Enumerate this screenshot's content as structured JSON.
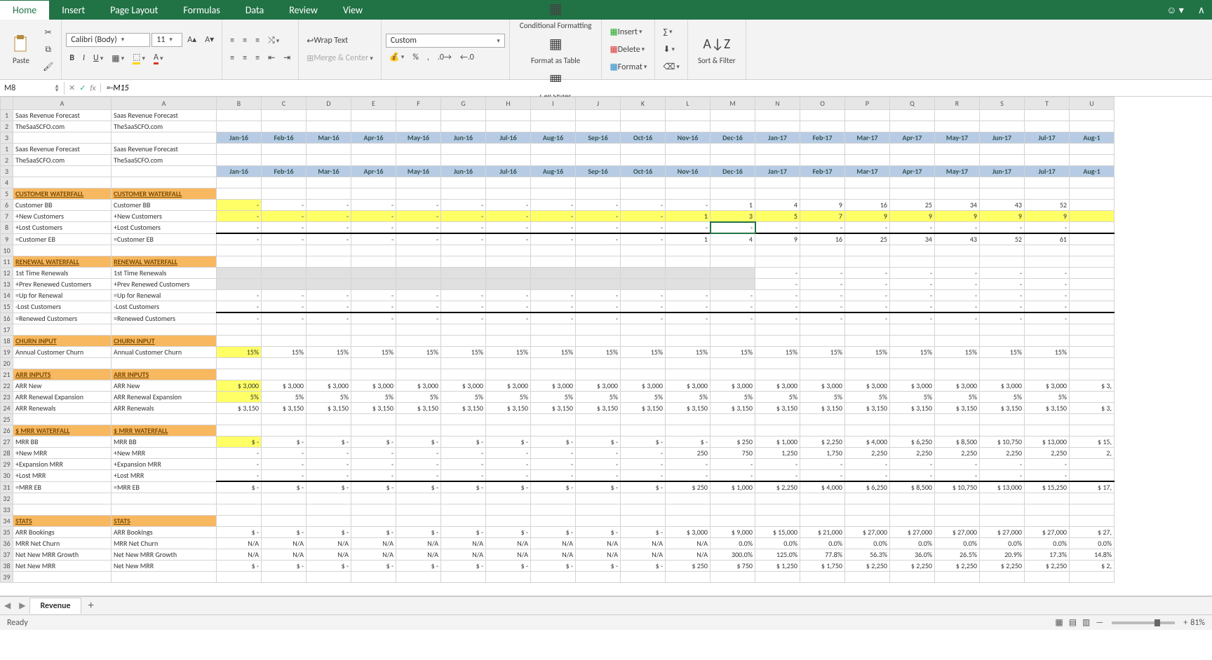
{
  "tabs": [
    "Home",
    "Insert",
    "Page Layout",
    "Formulas",
    "Data",
    "Review",
    "View"
  ],
  "activeTab": "Home",
  "ribbon": {
    "paste": "Paste",
    "font": "Calibri (Body)",
    "fontsize": "11",
    "wrap": "Wrap Text",
    "merge": "Merge & Center",
    "numfmt": "Custom",
    "cond": "Conditional Formatting",
    "fastbl": "Format as Table",
    "cellst": "Cell Styles",
    "insert": "Insert",
    "delete": "Delete",
    "format": "Format",
    "sortfilter": "Sort & Filter"
  },
  "namebox": "M8",
  "formula": "=-M15",
  "cols": [
    "",
    "A",
    "A",
    "B",
    "C",
    "D",
    "E",
    "F",
    "G",
    "H",
    "I",
    "J",
    "K",
    "L",
    "M",
    "N",
    "O",
    "P",
    "Q",
    "R",
    "S",
    "T",
    "U"
  ],
  "months": [
    "Jan-16",
    "Feb-16",
    "Mar-16",
    "Apr-16",
    "May-16",
    "Jun-16",
    "Jul-16",
    "Aug-16",
    "Sep-16",
    "Oct-16",
    "Nov-16",
    "Dec-16",
    "Jan-17",
    "Feb-17",
    "Mar-17",
    "Apr-17",
    "May-17",
    "Jun-17",
    "Jul-17",
    "Aug-1"
  ],
  "months2": [
    "Jan-16",
    "Feb-16",
    "Mar-16",
    "Apr-16",
    "May-16",
    "Jun-16",
    "Jul-16",
    "Aug-16",
    "Sep-16",
    "Oct-16",
    "Nov-16",
    "Dec-16",
    "Jan-17",
    "Feb-17",
    "Mar-17",
    "Apr-17",
    "May-17",
    "Jun-17",
    "Jul-17",
    "Aug-1"
  ],
  "labels": {
    "title": "Saas Revenue Forecast",
    "site": "TheSaaSCFO.com",
    "s_custw": "CUSTOMER WATERFALL",
    "custbb": "Customer BB",
    "newcust": "+New Customers",
    "lostcust": "+Lost Customers",
    "custeb": "=Customer EB",
    "s_renw": "RENEWAL WATERFALL",
    "first": "1st Time Renewals",
    "prev": "+Prev Renewed Customers",
    "upfor": "=Up for Renewal",
    "lostc": "-Lost Customers",
    "renewed": "=Renewed Customers",
    "s_churn": "CHURN INPUT",
    "annchurn": "Annual Customer Churn",
    "s_arr": "ARR INPUTS",
    "arrnew": "ARR New",
    "arrexp": "ARR Renewal Expansion",
    "arrren": "ARR Renewals",
    "s_mrrw": "$ MRR WATERFALL",
    "mrrbb": "MRR BB",
    "newmrr": "+New MRR",
    "expmrr": "+Expansion MRR",
    "lostmrr": "+Lost MRR",
    "mrreb": "=MRR EB",
    "s_stats": "STATS",
    "arrbook": "ARR Bookings",
    "mnc": "MRR Net Churn",
    "nngrowth": "Net New MRR Growth",
    "nnmrr": "Net New MRR"
  },
  "data": {
    "custbb": [
      "-",
      "-",
      "-",
      "-",
      "-",
      "-",
      "-",
      "-",
      "-",
      "-",
      "-",
      "1",
      "4",
      "9",
      "16",
      "25",
      "34",
      "43",
      "52",
      ""
    ],
    "newcust": [
      "-",
      "-",
      "-",
      "-",
      "-",
      "-",
      "-",
      "-",
      "-",
      "-",
      "1",
      "3",
      "5",
      "7",
      "9",
      "9",
      "9",
      "9",
      "9",
      ""
    ],
    "lostcust": [
      "-",
      "-",
      "-",
      "-",
      "-",
      "-",
      "-",
      "-",
      "-",
      "-",
      "-",
      "-",
      "-",
      "-",
      "-",
      "-",
      "-",
      "-",
      "-",
      ""
    ],
    "custeb": [
      "-",
      "-",
      "-",
      "-",
      "-",
      "-",
      "-",
      "-",
      "-",
      "-",
      "1",
      "4",
      "9",
      "16",
      "25",
      "34",
      "43",
      "52",
      "61",
      ""
    ],
    "first": [
      "",
      "",
      "",
      "",
      "",
      "",
      "",
      "",
      "",
      "",
      "",
      "",
      "-",
      "-",
      "-",
      "-",
      "-",
      "-",
      "-",
      ""
    ],
    "prev": [
      "",
      "",
      "",
      "",
      "",
      "",
      "",
      "",
      "",
      "",
      "",
      "",
      "-",
      "-",
      "-",
      "-",
      "-",
      "-",
      "-",
      ""
    ],
    "upfor": [
      "-",
      "-",
      "-",
      "-",
      "-",
      "-",
      "-",
      "-",
      "-",
      "-",
      "-",
      "-",
      "-",
      "-",
      "-",
      "-",
      "-",
      "-",
      "-",
      ""
    ],
    "lostc": [
      "-",
      "-",
      "-",
      "-",
      "-",
      "-",
      "-",
      "-",
      "-",
      "-",
      "-",
      "-",
      "-",
      "-",
      "-",
      "-",
      "-",
      "-",
      "-",
      ""
    ],
    "renewed": [
      "-",
      "-",
      "-",
      "-",
      "-",
      "-",
      "-",
      "-",
      "-",
      "-",
      "-",
      "-",
      "-",
      "-",
      "-",
      "-",
      "-",
      "-",
      "-",
      ""
    ],
    "churn": [
      "15%",
      "15%",
      "15%",
      "15%",
      "15%",
      "15%",
      "15%",
      "15%",
      "15%",
      "15%",
      "15%",
      "15%",
      "15%",
      "15%",
      "15%",
      "15%",
      "15%",
      "15%",
      "15%",
      ""
    ],
    "arrnew": [
      "$   3,000",
      "$   3,000",
      "$   3,000",
      "$   3,000",
      "$   3,000",
      "$   3,000",
      "$   3,000",
      "$   3,000",
      "$   3,000",
      "$   3,000",
      "$   3,000",
      "$   3,000",
      "$   3,000",
      "$   3,000",
      "$   3,000",
      "$   3,000",
      "$   3,000",
      "$   3,000",
      "$   3,000",
      "$   3,"
    ],
    "arrexp": [
      "5%",
      "5%",
      "5%",
      "5%",
      "5%",
      "5%",
      "5%",
      "5%",
      "5%",
      "5%",
      "5%",
      "5%",
      "5%",
      "5%",
      "5%",
      "5%",
      "5%",
      "5%",
      "5%",
      ""
    ],
    "arrren": [
      "$   3,150",
      "$   3,150",
      "$   3,150",
      "$   3,150",
      "$   3,150",
      "$   3,150",
      "$   3,150",
      "$   3,150",
      "$   3,150",
      "$   3,150",
      "$   3,150",
      "$   3,150",
      "$   3,150",
      "$   3,150",
      "$   3,150",
      "$   3,150",
      "$   3,150",
      "$   3,150",
      "$   3,150",
      "$   3,"
    ],
    "mrrbb": [
      "$   -",
      "$   -",
      "$   -",
      "$   -",
      "$   -",
      "$   -",
      "$   -",
      "$   -",
      "$   -",
      "$   -",
      "$   -",
      "$   250",
      "$   1,000",
      "$   2,250",
      "$   4,000",
      "$   6,250",
      "$   8,500",
      "$   10,750",
      "$   13,000",
      "$   15,"
    ],
    "newmrr": [
      "-",
      "-",
      "-",
      "-",
      "-",
      "-",
      "-",
      "-",
      "-",
      "-",
      "250",
      "750",
      "1,250",
      "1,750",
      "2,250",
      "2,250",
      "2,250",
      "2,250",
      "2,250",
      "2,"
    ],
    "expmrr": [
      "-",
      "-",
      "-",
      "-",
      "-",
      "-",
      "-",
      "-",
      "-",
      "-",
      "-",
      "-",
      "-",
      "-",
      "-",
      "-",
      "-",
      "-",
      "-",
      ""
    ],
    "lostmrr": [
      "-",
      "-",
      "-",
      "-",
      "-",
      "-",
      "-",
      "-",
      "-",
      "-",
      "-",
      "-",
      "-",
      "-",
      "-",
      "-",
      "-",
      "-",
      "-",
      ""
    ],
    "mrreb": [
      "$   -",
      "$   -",
      "$   -",
      "$   -",
      "$   -",
      "$   -",
      "$   -",
      "$   -",
      "$   -",
      "$   -",
      "$   250",
      "$   1,000",
      "$   2,250",
      "$   4,000",
      "$   6,250",
      "$   8,500",
      "$   10,750",
      "$   13,000",
      "$   15,250",
      "$   17,"
    ],
    "arrbook": [
      "$   -",
      "$   -",
      "$   -",
      "$   -",
      "$   -",
      "$   -",
      "$   -",
      "$   -",
      "$   -",
      "$   -",
      "$   3,000",
      "$   9,000",
      "$   15,000",
      "$   21,000",
      "$   27,000",
      "$   27,000",
      "$   27,000",
      "$   27,000",
      "$   27,000",
      "$   27,"
    ],
    "mnc": [
      "N/A",
      "N/A",
      "N/A",
      "N/A",
      "N/A",
      "N/A",
      "N/A",
      "N/A",
      "N/A",
      "N/A",
      "N/A",
      "0.0%",
      "0.0%",
      "0.0%",
      "0.0%",
      "0.0%",
      "0.0%",
      "0.0%",
      "0.0%",
      "0.0%"
    ],
    "nngrowth": [
      "N/A",
      "N/A",
      "N/A",
      "N/A",
      "N/A",
      "N/A",
      "N/A",
      "N/A",
      "N/A",
      "N/A",
      "N/A",
      "300.0%",
      "125.0%",
      "77.8%",
      "56.3%",
      "36.0%",
      "26.5%",
      "20.9%",
      "17.3%",
      "14.8%"
    ],
    "nnmrr": [
      "$   -",
      "$   -",
      "$   -",
      "$   -",
      "$   -",
      "$   -",
      "$   -",
      "$   -",
      "$   -",
      "$   -",
      "$   250",
      "$   750",
      "$   1,250",
      "$   1,750",
      "$   2,250",
      "$   2,250",
      "$   2,250",
      "$   2,250",
      "$   2,250",
      "$   2,"
    ]
  },
  "sheet": "Revenue",
  "status": "Ready",
  "zoom": "81%"
}
